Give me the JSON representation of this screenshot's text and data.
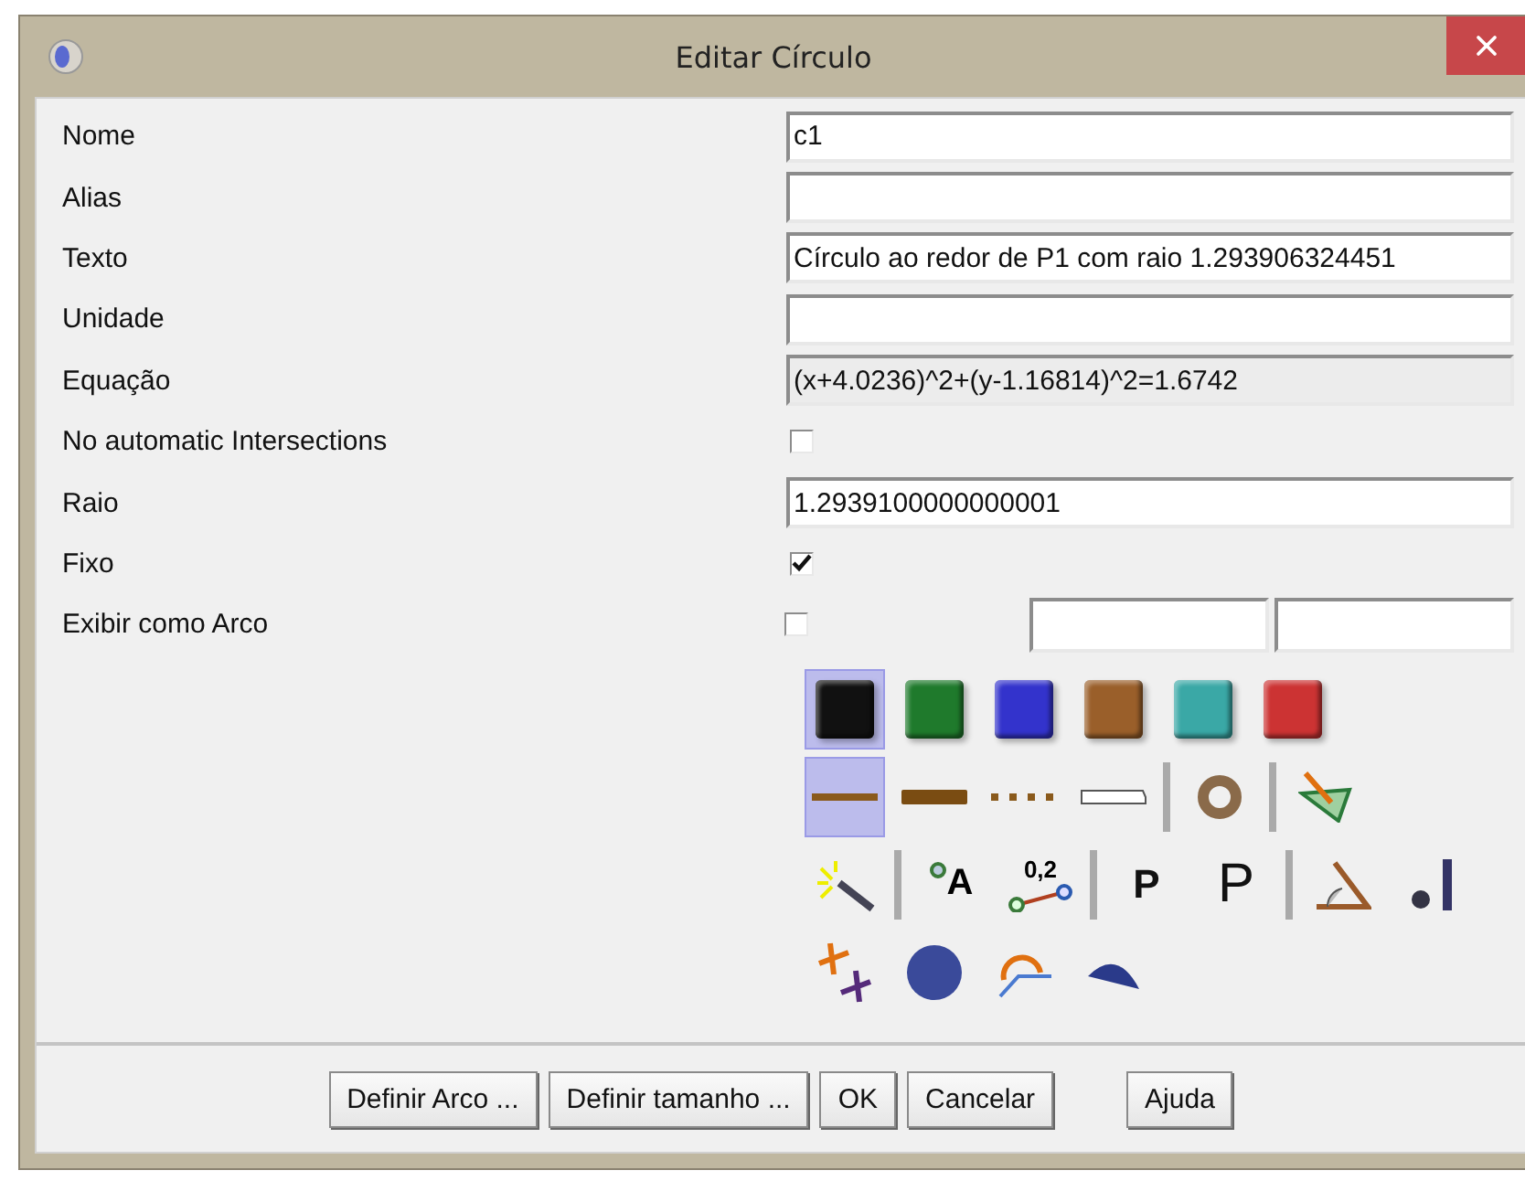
{
  "window": {
    "title": "Editar Círculo"
  },
  "fields": [
    {
      "label": "Nome",
      "kind": "text",
      "value": "c1",
      "disabled": false
    },
    {
      "label": "Alias",
      "kind": "text",
      "disabled": false
    },
    {
      "label": "Texto",
      "kind": "text",
      "value": "Círculo ao redor de P1 com raio 1.293906324451",
      "disabled": false
    },
    {
      "label": "Unidade",
      "kind": "text",
      "disabled": false
    },
    {
      "label": "Equação",
      "kind": "text",
      "value": "(x+4.0236)^2+(y-1.16814)^2=1.6742",
      "disabled": true
    },
    {
      "label": "No automatic Intersections",
      "kind": "checkbox",
      "checked": false
    },
    {
      "label": "Raio",
      "kind": "text",
      "value": "1.2939100000000001",
      "disabled": false
    },
    {
      "label": "Fixo",
      "kind": "checkbox",
      "checked": true
    },
    {
      "label": "Exibir como Arco",
      "kind": "arc",
      "checked": false
    }
  ],
  "palette": [
    [
      {
        "kind": "color",
        "color": "#111111",
        "selected": true
      },
      {
        "kind": "color",
        "color": "#1f7a2c",
        "selected": false
      },
      {
        "kind": "color",
        "color": "#3333cc",
        "selected": false
      },
      {
        "kind": "color",
        "color": "#9a5f2a",
        "selected": false
      },
      {
        "kind": "color",
        "color": "#3aa8a6",
        "selected": false
      },
      {
        "kind": "color",
        "color": "#cc3333",
        "selected": false
      }
    ],
    [
      {
        "kind": "line",
        "selected": true
      },
      {
        "kind": "line",
        "selected": false
      },
      {
        "kind": "line",
        "selected": false
      },
      {
        "kind": "line",
        "selected": false
      },
      {
        "kind": "separator"
      },
      {
        "kind": "icon"
      },
      {
        "kind": "separator"
      },
      {
        "kind": "icon"
      }
    ],
    [
      {
        "kind": "icon"
      },
      {
        "kind": "separator"
      },
      {
        "kind": "point",
        "label": "A"
      },
      {
        "kind": "segment",
        "label": "0,2"
      },
      {
        "kind": "separator"
      },
      {
        "kind": "letter",
        "label": "P",
        "bold": true
      },
      {
        "kind": "letter",
        "label": "P",
        "bold": false
      },
      {
        "kind": "separator"
      },
      {
        "kind": "icon"
      },
      {
        "kind": "icon"
      }
    ],
    [
      {
        "kind": "icon"
      },
      {
        "kind": "icon"
      },
      {
        "kind": "icon"
      },
      {
        "kind": "icon"
      }
    ]
  ],
  "buttons": [
    "Definir Arco ...",
    "Definir tamanho ...",
    "OK",
    "Cancelar"
  ],
  "help": "Ajuda"
}
